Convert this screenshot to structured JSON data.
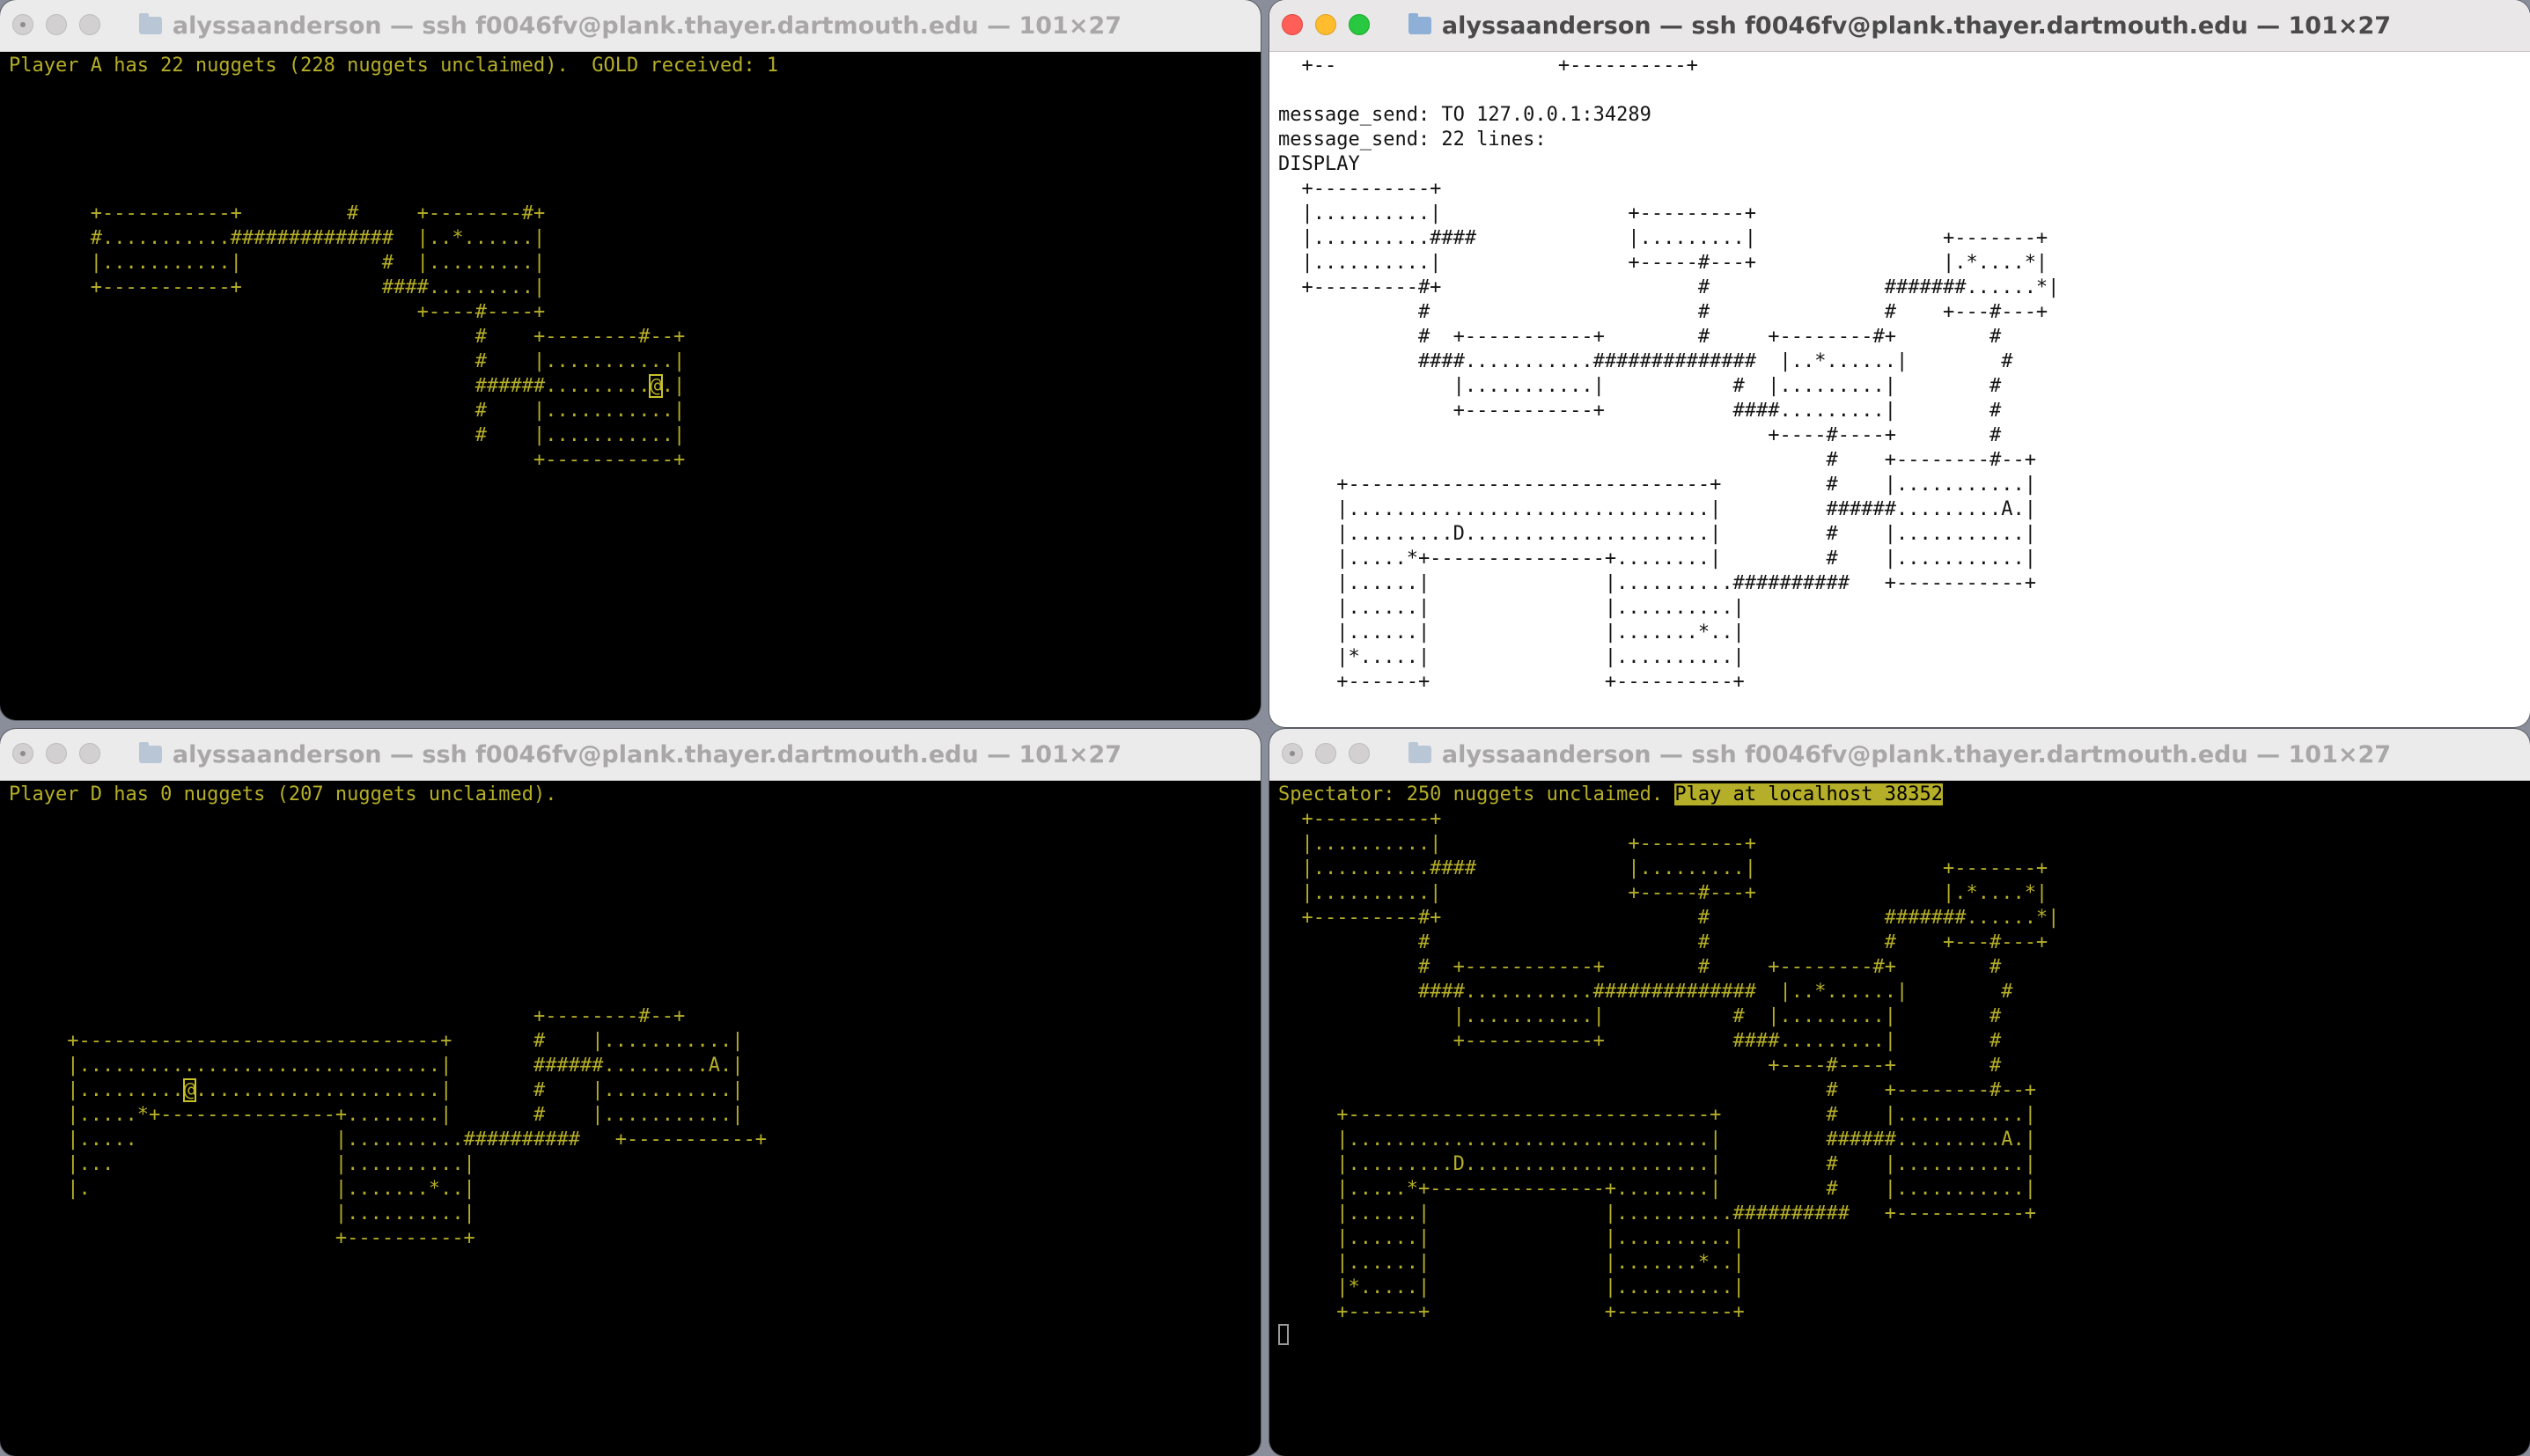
{
  "windows": [
    {
      "title": "alyssaanderson — ssh f0046fv@plank.thayer.dartmouth.edu — 101×27",
      "status": "Player A has 22 nuggets (228 nuggets unclaimed).  GOLD received: 1",
      "map_before": "\n\n\n\n\n       +-----------+         #     +--------#+\n       #...........##############  |..*......|\n       |...........|            #  |.........|\n       +-----------+            ####.........|\n                                   +----#----+\n                                        #    +--------#--+\n                                        #    |...........|\n                                        ######.........",
      "map_cursor": "@",
      "map_after": ".|\n                                        #    |...........|\n                                        #    |...........|\n                                             +-----------+"
    },
    {
      "title": "alyssaanderson — ssh f0046fv@plank.thayer.dartmouth.edu — 101×27",
      "log": "  +--                   +----------+\n\nmessage_send: TO 127.0.0.1:34289\nmessage_send: 22 lines:\nDISPLAY\n  +----------+\n  |..........|                +---------+\n  |..........####             |.........|                +-------+\n  |..........|                +-----#---+                |.*....*|\n  +---------#+                      #               #######......*|\n            #                       #               #    +---#---+\n            #  +-----------+        #     +--------#+        #\n            ####...........##############  |..*......|        #\n               |...........|           #  |.........|        #\n               +-----------+           ####.........|        #\n                                          +----#----+        #\n                                               #    +--------#--+\n     +-------------------------------+         #    |...........|\n     |...............................|         ######.........A.|\n     |.........D.....................|         #    |...........|\n     |.....*+---------------+........|         #    |...........|\n     |......|               |..........##########   +-----------+\n     |......|               |..........|\n     |......|               |.......*..|\n     |*.....|               |..........|\n     +------+               +----------+"
    },
    {
      "title": "alyssaanderson — ssh f0046fv@plank.thayer.dartmouth.edu — 101×27",
      "status": "Player D has 0 nuggets (207 nuggets unclaimed).",
      "map_before": "\n\n\n\n\n\n\n\n                                             +--------#--+\n     +-------------------------------+       #    |...........|\n     |...............................|       ######.........A.|\n     |.........",
      "map_cursor": "@",
      "map_after": ".....................|       #    |...........|\n     |.....*+---------------+........|       #    |...........|\n     |.....                 |..........##########   +-----------+\n     |...                   |..........|\n     |.                     |.......*..|\n                            |..........|\n                            +----------+"
    },
    {
      "title": "alyssaanderson — ssh f0046fv@plank.thayer.dartmouth.edu — 101×27",
      "status": "Spectator: 250 nuggets unclaimed. ",
      "status_highlight": "Play at localhost 38352",
      "map": "  +----------+\n  |..........|                +---------+\n  |..........####             |.........|                +-------+\n  |..........|                +-----#---+                |.*....*|\n  +---------#+                      #               #######......*|\n            #                       #               #    +---#---+\n            #  +-----------+        #     +--------#+        #\n            ####...........##############  |..*......|        #\n               |...........|           #  |.........|        #\n               +-----------+           ####.........|        #\n                                          +----#----+        #\n                                               #    +--------#--+\n     +-------------------------------+         #    |...........|\n     |...............................|         ######.........A.|\n     |.........D.....................|         #    |...........|\n     |.....*+---------------+........|         #    |...........|\n     |......|               |..........##########   +-----------+\n     |......|               |..........|\n     |......|               |.......*..|\n     |*.....|               |..........|\n     +------+               +----------+"
    }
  ]
}
